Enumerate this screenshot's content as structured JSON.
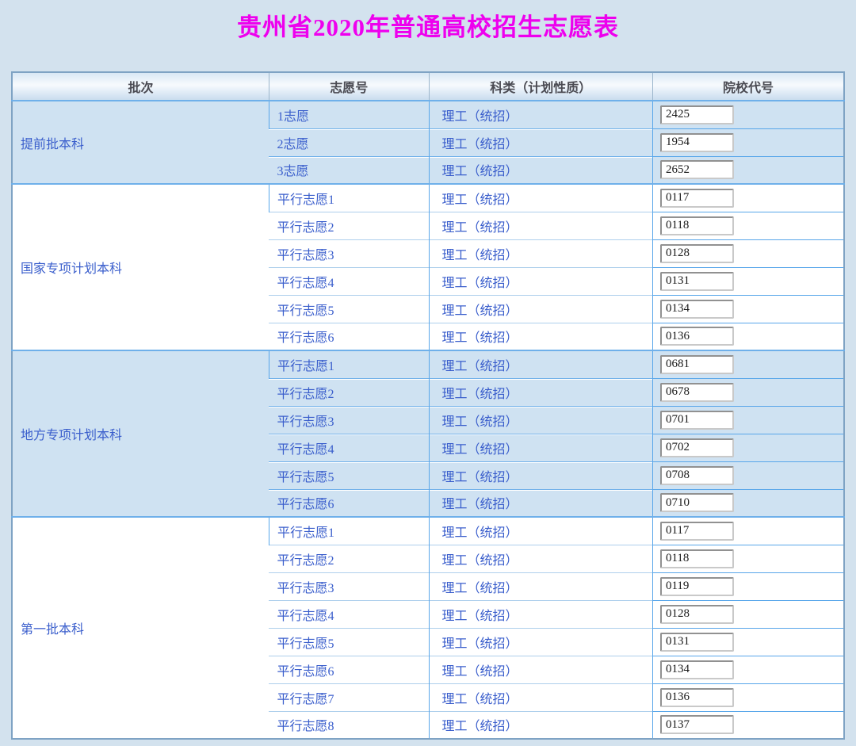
{
  "page": {
    "title": "贵州省2020年普通高校招生志愿表"
  },
  "colors": {
    "title": "#ee00ee",
    "cell_text": "#3a5ecc",
    "header_text": "#4a4a52",
    "page_background": "#d3e2ee",
    "row_blue": "#cfe2f2",
    "row_white": "#ffffff",
    "grid_blue": "#58a6ea"
  },
  "table": {
    "headers": [
      "批次",
      "志愿号",
      "科类（计划性质）",
      "院校代号"
    ],
    "groups": [
      {
        "batch": "提前批本科",
        "shade": "blue",
        "rows": [
          {
            "wish": "1志愿",
            "category": "理工（统招）",
            "code": "2425"
          },
          {
            "wish": "2志愿",
            "category": "理工（统招）",
            "code": "1954"
          },
          {
            "wish": "3志愿",
            "category": "理工（统招）",
            "code": "2652"
          }
        ]
      },
      {
        "batch": "国家专项计划本科",
        "shade": "white",
        "rows": [
          {
            "wish": "平行志愿1",
            "category": "理工（统招）",
            "code": "0117"
          },
          {
            "wish": "平行志愿2",
            "category": "理工（统招）",
            "code": "0118"
          },
          {
            "wish": "平行志愿3",
            "category": "理工（统招）",
            "code": "0128"
          },
          {
            "wish": "平行志愿4",
            "category": "理工（统招）",
            "code": "0131"
          },
          {
            "wish": "平行志愿5",
            "category": "理工（统招）",
            "code": "0134"
          },
          {
            "wish": "平行志愿6",
            "category": "理工（统招）",
            "code": "0136"
          }
        ]
      },
      {
        "batch": "地方专项计划本科",
        "shade": "blue",
        "rows": [
          {
            "wish": "平行志愿1",
            "category": "理工（统招）",
            "code": "0681"
          },
          {
            "wish": "平行志愿2",
            "category": "理工（统招）",
            "code": "0678"
          },
          {
            "wish": "平行志愿3",
            "category": "理工（统招）",
            "code": "0701"
          },
          {
            "wish": "平行志愿4",
            "category": "理工（统招）",
            "code": "0702"
          },
          {
            "wish": "平行志愿5",
            "category": "理工（统招）",
            "code": "0708"
          },
          {
            "wish": "平行志愿6",
            "category": "理工（统招）",
            "code": "0710"
          }
        ]
      },
      {
        "batch": "第一批本科",
        "shade": "white",
        "rows": [
          {
            "wish": "平行志愿1",
            "category": "理工（统招）",
            "code": "0117"
          },
          {
            "wish": "平行志愿2",
            "category": "理工（统招）",
            "code": "0118"
          },
          {
            "wish": "平行志愿3",
            "category": "理工（统招）",
            "code": "0119"
          },
          {
            "wish": "平行志愿4",
            "category": "理工（统招）",
            "code": "0128"
          },
          {
            "wish": "平行志愿5",
            "category": "理工（统招）",
            "code": "0131"
          },
          {
            "wish": "平行志愿6",
            "category": "理工（统招）",
            "code": "0134"
          },
          {
            "wish": "平行志愿7",
            "category": "理工（统招）",
            "code": "0136"
          },
          {
            "wish": "平行志愿8",
            "category": "理工（统招）",
            "code": "0137"
          }
        ]
      }
    ]
  }
}
